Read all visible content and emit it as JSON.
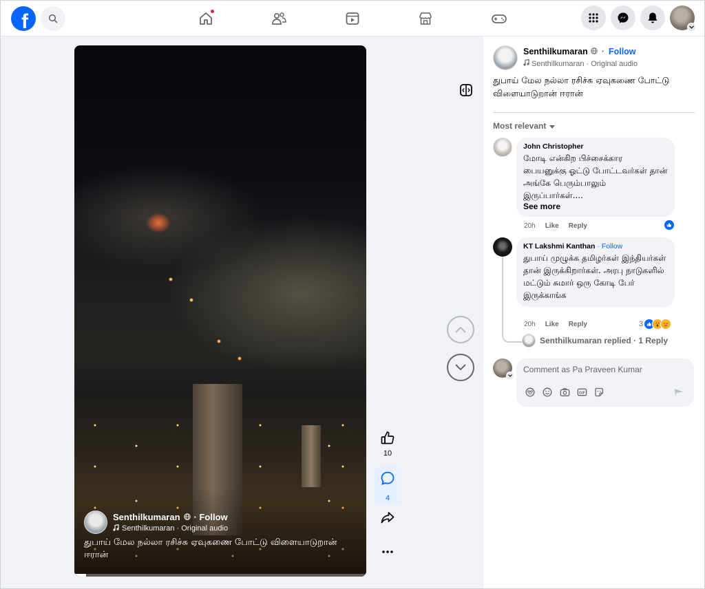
{
  "topbar": {
    "logo_letter": "f",
    "nav": [
      "home",
      "friends",
      "video",
      "marketplace",
      "gaming"
    ],
    "home_has_notification": true
  },
  "video": {
    "author": "Senthilkumaran",
    "follow": "· Follow",
    "audio": "Senthilkumaran · Original audio",
    "caption": "துபாய் மேல நல்லா ரசிச்சு ஏவுகணை போட்டு விளையாடுறான் ஈரான்",
    "progress": 0.04
  },
  "actions": {
    "likes": "10",
    "comments": "4"
  },
  "post": {
    "author": "Senthilkumaran",
    "follow": "Follow",
    "audio": "Senthilkumaran · Original audio",
    "caption": "துபாய் மேல நல்லா ரசிச்சு ஏவுகணை போட்டு விளையாடுறான் ஈரான்"
  },
  "comments": {
    "sort_label": "Most relevant",
    "items": [
      {
        "author": "John Christopher",
        "follow": "",
        "text": "மோடி என்கிற பிச்சைக்கார பையனுக்கு ஓட்டு போட்டவர்கள் தான் அங்கே பெரும்பாலும் இருப்பார்கள்....",
        "see_more": "See more",
        "time": "20h",
        "like": "Like",
        "reply": "Reply"
      },
      {
        "author": "KT Lakshmi Kanthan",
        "follow": "· Follow",
        "text": "துபாய் முழுக்க தமிழர்கள் இந்தியர்கள் தான் இருக்கிறார்கள். அரபு நாடுகளில் மட்டும் சுமார் ஒரு கோடி பேர் இருக்காங்க",
        "time": "20h",
        "like": "Like",
        "reply": "Reply",
        "reaction_count": "3"
      }
    ],
    "replied_text": "Senthilkumaran replied · 1 Reply"
  },
  "composer": {
    "placeholder": "Comment as Pa Praveen Kumar"
  },
  "colors": {
    "brand": "#0866ff",
    "notification": "#e41e3f",
    "pane_bg": "#f0f2f5"
  }
}
